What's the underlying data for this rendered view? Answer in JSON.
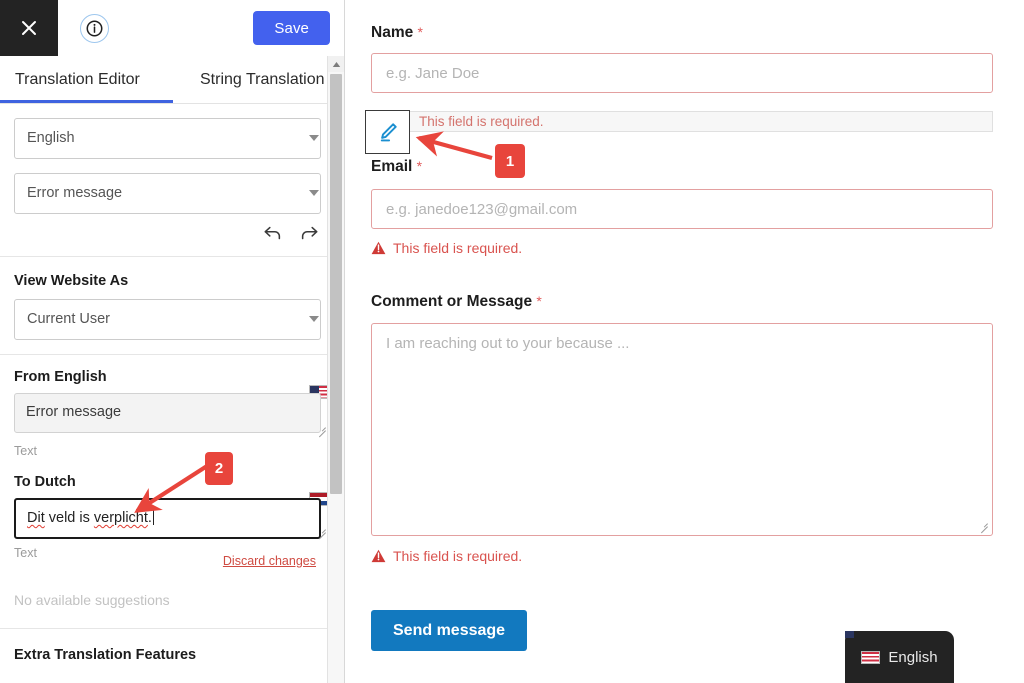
{
  "sidebar": {
    "header": {
      "close_icon": "close-x-icon",
      "info_icon": "info-circle-icon",
      "save_label": "Save"
    },
    "tabs": [
      {
        "label": "Translation Editor",
        "active": true
      },
      {
        "label": "String Translation",
        "active": false
      }
    ],
    "language_select": {
      "value": "English",
      "caret_icon": "chevron-down-icon"
    },
    "string_type_select": {
      "value": "Error message",
      "caret_icon": "chevron-down-icon"
    },
    "history": {
      "undo_icon": "undo-arrow-icon",
      "redo_icon": "redo-arrow-icon"
    },
    "view_website_as": {
      "title": "View Website As",
      "value": "Current User",
      "caret_icon": "chevron-down-icon"
    },
    "source": {
      "title": "From English",
      "flag_icon": "flag-us-icon",
      "value": "Error message",
      "sub_label": "Text"
    },
    "target": {
      "title": "To Dutch",
      "flag_icon": "flag-nl-icon",
      "value_parts": {
        "word1": "Dit",
        "mid": " veld is ",
        "word2": "verplicht",
        "tail": "."
      },
      "value": "Dit veld is verplicht.",
      "sub_label": "Text",
      "discard_label": "Discard changes"
    },
    "suggestions": {
      "empty_text": "No available suggestions"
    },
    "extra_features": {
      "title": "Extra Translation Features"
    },
    "scrollbar": {
      "up_arrow_icon": "scroll-up-arrow-icon"
    }
  },
  "main": {
    "highlighted_string": {
      "text": "This field is required.",
      "edit_icon": "pencil-edit-icon"
    },
    "fields": [
      {
        "label": "Name",
        "required_mark": "*",
        "placeholder": "e.g. Jane Doe",
        "value": ""
      },
      {
        "label": "Email",
        "required_mark": "*",
        "placeholder": "e.g. janedoe123@gmail.com",
        "value": "",
        "error": "This field is required.",
        "error_icon": "warning-triangle-icon"
      },
      {
        "label": "Comment or Message",
        "required_mark": "*",
        "placeholder": "I am reaching out to your because ...",
        "value": "",
        "error": "This field is required.",
        "error_icon": "warning-triangle-icon"
      }
    ],
    "submit_label": "Send message",
    "language_switcher": {
      "label": "English",
      "flag_icon": "flag-us-icon"
    }
  },
  "annotations": {
    "markers": [
      {
        "id": "1",
        "label": "1"
      },
      {
        "id": "2",
        "label": "2"
      }
    ],
    "color": "#e8453c"
  },
  "colors": {
    "save_button": "#4361ee",
    "send_button": "#1279bf",
    "tab_active_underline": "#3f63e0",
    "error_text": "#d9534f",
    "error_border": "#e3a0a0",
    "annotation": "#e8453c",
    "close_button_bg": "#232323"
  }
}
